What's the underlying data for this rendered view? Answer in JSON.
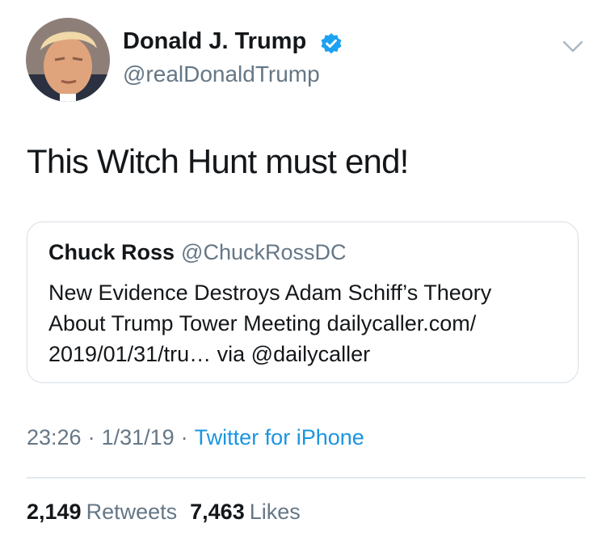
{
  "tweet": {
    "author": {
      "display_name": "Donald J. Trump",
      "handle": "@realDonaldTrump",
      "verified": true,
      "avatar": "profile-photo"
    },
    "text": "This Witch Hunt must end!",
    "quoted": {
      "name": "Chuck Ross",
      "handle": "@ChuckRossDC",
      "lines": [
        "New Evidence Destroys Adam Schiff’s Theory",
        "About Trump Tower Meeting dailycaller.com/",
        "2019/01/31/tru… via @dailycaller"
      ]
    },
    "meta": {
      "time": "23:26",
      "separator": "·",
      "date": "1/31/19",
      "source": "Twitter for iPhone"
    },
    "stats": {
      "retweets_count": "2,149",
      "retweets_label": "Retweets",
      "likes_count": "7,463",
      "likes_label": "Likes"
    }
  },
  "icons": {
    "verified": "verified-badge-icon",
    "menu": "chevron-down-icon"
  },
  "colors": {
    "text_primary": "#14171a",
    "text_secondary": "#657786",
    "link": "#1b95e0",
    "verified": "#1da1f2",
    "border": "#d8dfe5"
  }
}
